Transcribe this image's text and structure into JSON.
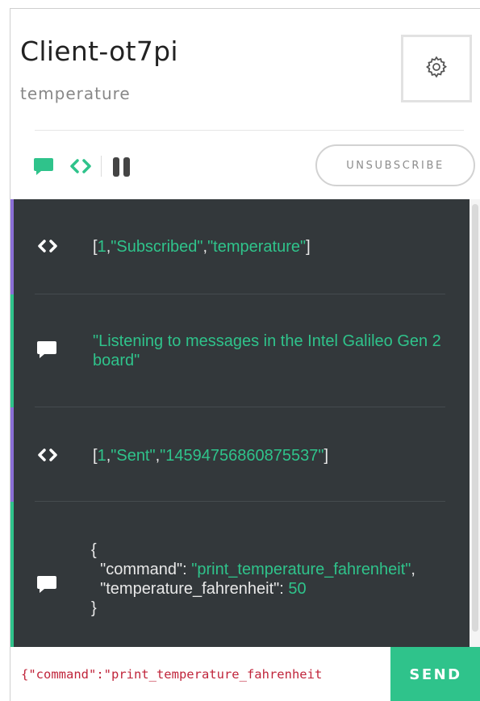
{
  "header": {
    "client_name": "Client-ot7pi",
    "channel": "temperature"
  },
  "toolbar": {
    "unsubscribe_label": "UNSUBSCRIBE"
  },
  "colors": {
    "accent": "#2fc38b",
    "log_background": "#33383b",
    "system_bar": "#8b6fd6",
    "message_bar": "#2fc38b",
    "input_text": "#c0253b"
  },
  "messages": [
    {
      "kind": "system",
      "icon": "code-icon",
      "parts": [
        "[",
        "1",
        ",",
        "\"Subscribed\"",
        ",",
        "\"temperature\"",
        "]"
      ]
    },
    {
      "kind": "message",
      "icon": "chat-bubble-icon",
      "text": "\"Listening to messages in the Intel Galileo Gen 2 board\""
    },
    {
      "kind": "system",
      "icon": "code-icon",
      "parts": [
        "[",
        "1",
        ",",
        "\"Sent\"",
        ",",
        "\"14594756860875537\"",
        "]"
      ]
    },
    {
      "kind": "message",
      "icon": "chat-bubble-icon",
      "json": {
        "open": "{",
        "key1": "\"command\"",
        "value1": "\"print_temperature_fahrenheit\"",
        "key2": "\"temperature_fahrenheit\"",
        "value2": "50",
        "close": "}"
      }
    }
  ],
  "composer": {
    "value": "{\"command\":\"print_temperature_fahrenheit",
    "send_label": "SEND"
  }
}
